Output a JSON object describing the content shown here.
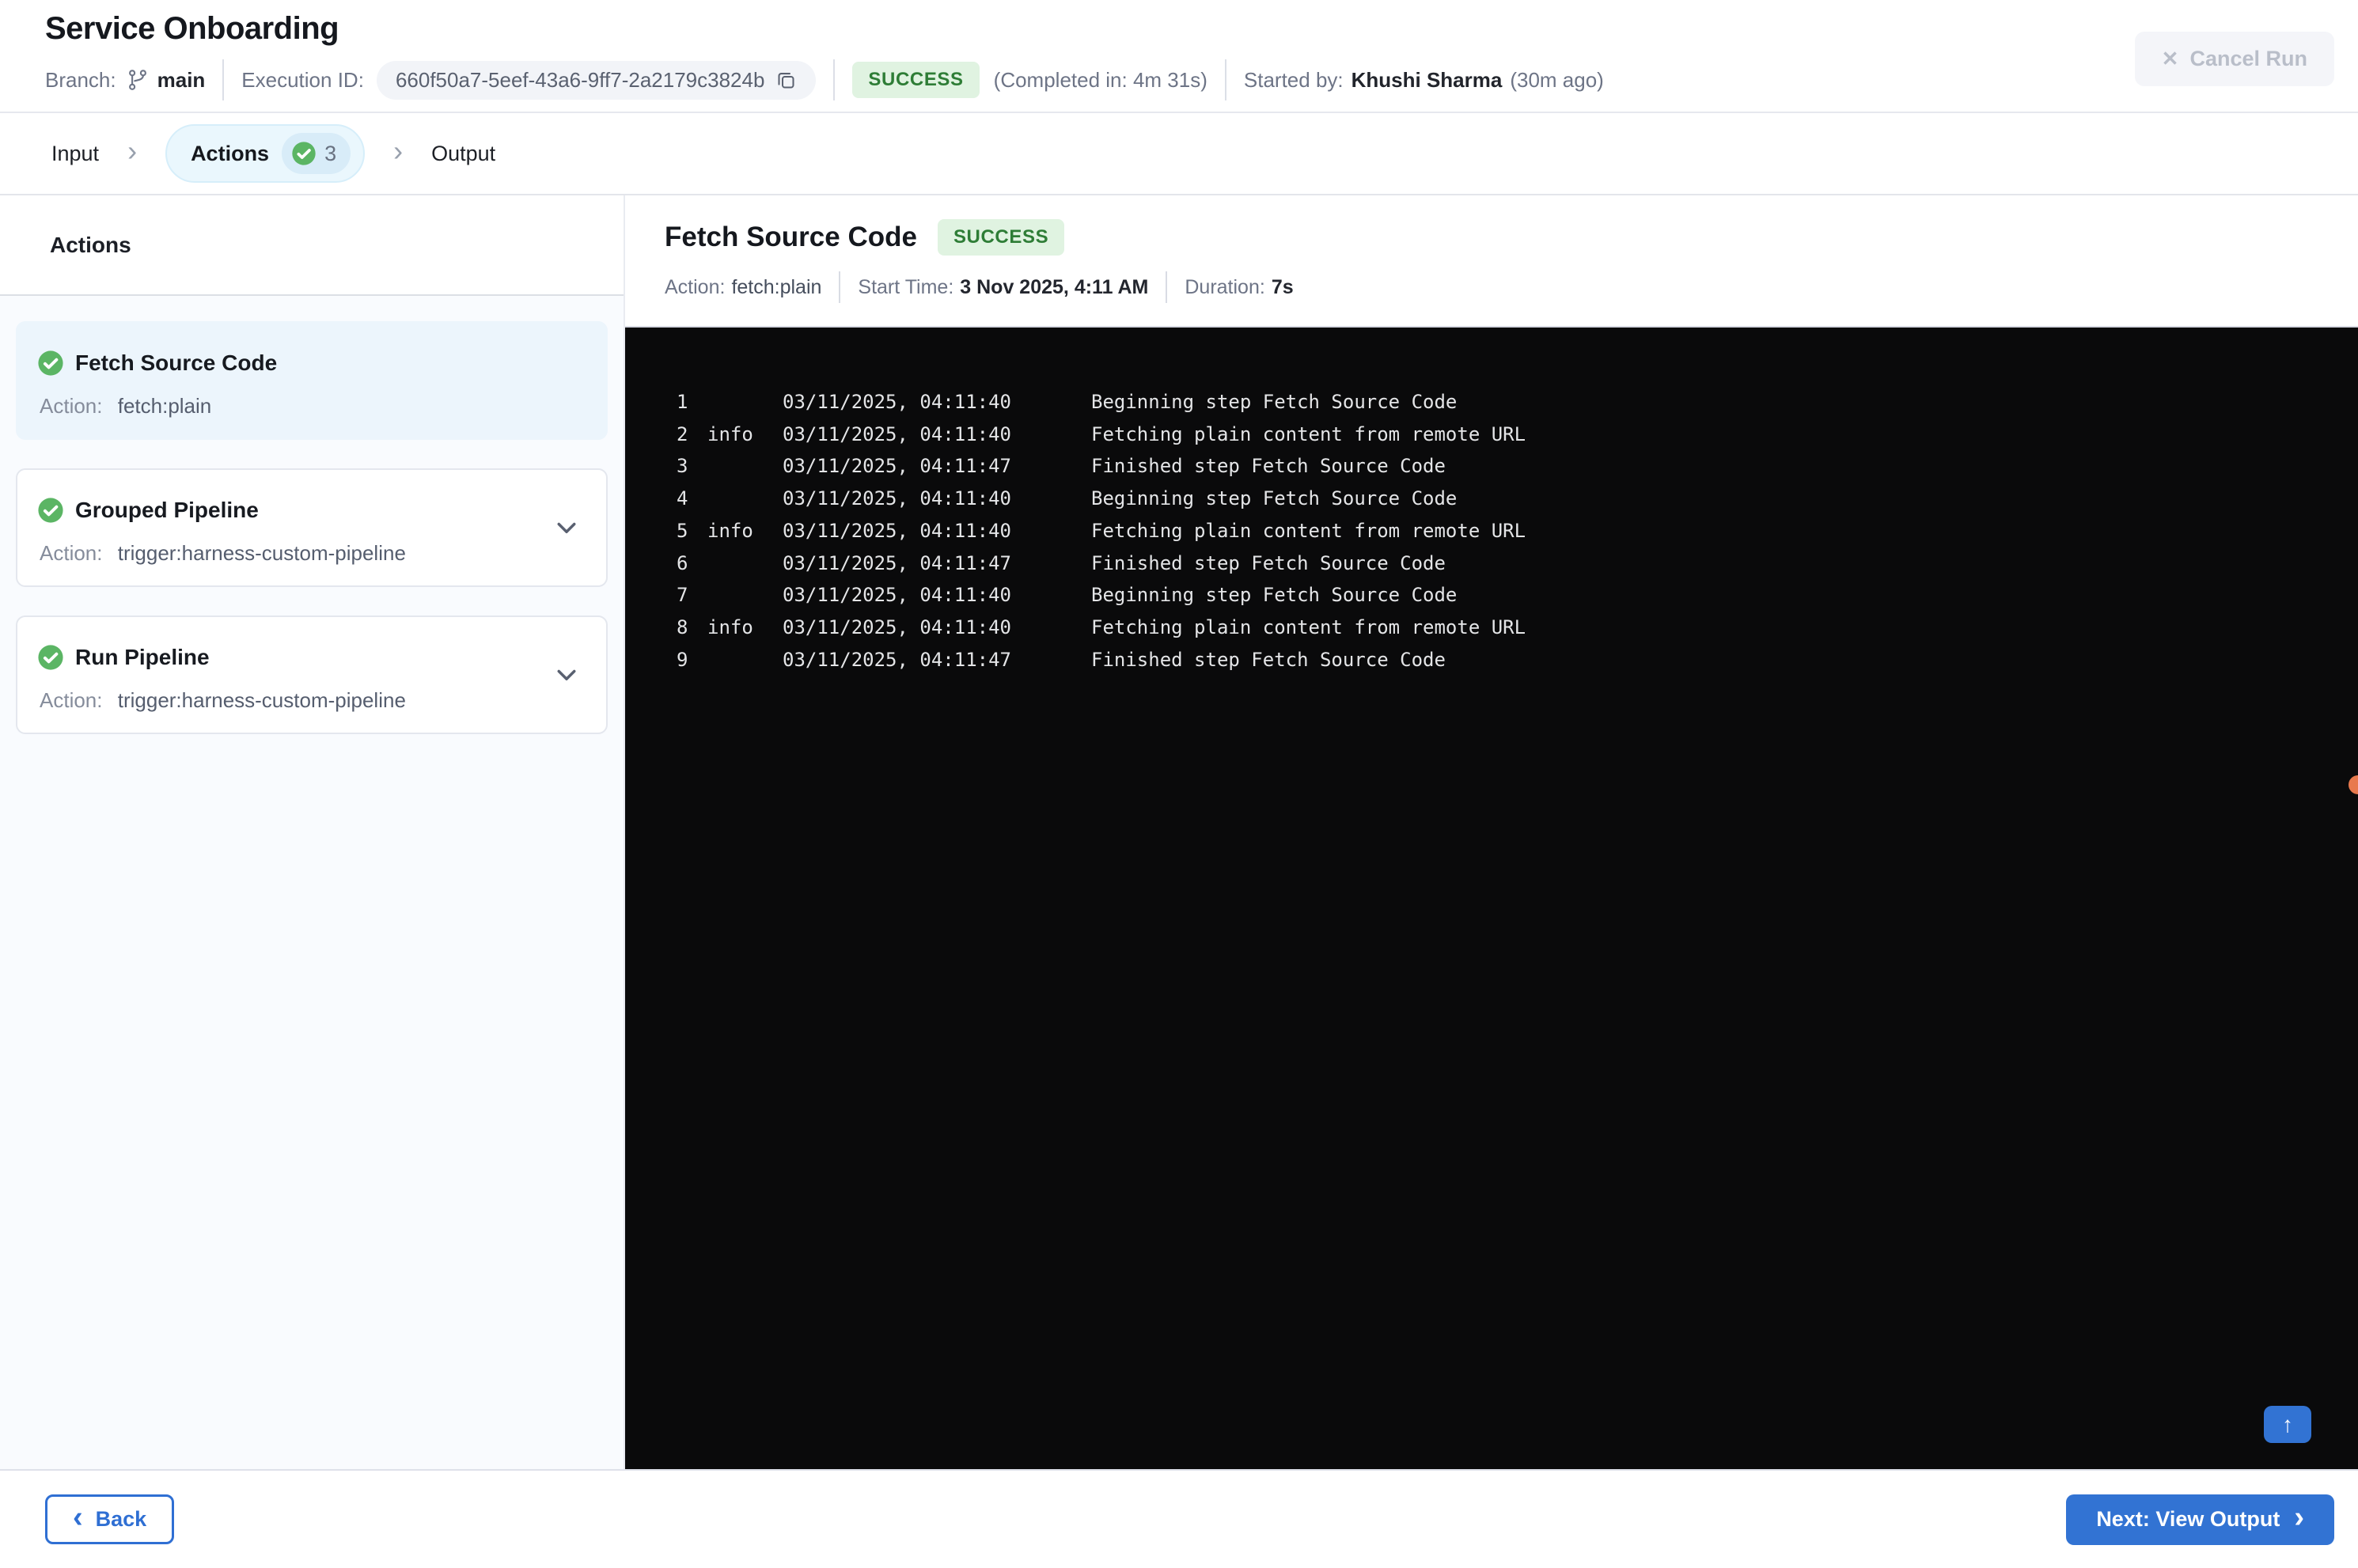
{
  "header": {
    "title": "Service Onboarding",
    "branch_label": "Branch:",
    "branch_name": "main",
    "execution_id_label": "Execution ID:",
    "execution_id": "660f50a7-5eef-43a6-9ff7-2a2179c3824b",
    "status_badge": "SUCCESS",
    "completed_in": "(Completed in: 4m 31s)",
    "started_by_label": "Started by:",
    "started_by_name": "Khushi Sharma",
    "started_ago": "(30m ago)",
    "cancel_button_label": "Cancel Run",
    "cancel_icon": "✕"
  },
  "tabs": {
    "items": [
      {
        "label": "Input",
        "active": false
      },
      {
        "label": "Actions",
        "active": true,
        "badge_count": "3"
      },
      {
        "label": "Output",
        "active": false
      }
    ],
    "separator": "›"
  },
  "sidebar": {
    "heading": "Actions",
    "action_label": "Action:",
    "cards": [
      {
        "title": "Fetch Source Code",
        "action": "fetch:plain",
        "status": "success",
        "selected": true,
        "expandable": false
      },
      {
        "title": "Grouped Pipeline",
        "action": "trigger:harness-custom-pipeline",
        "status": "success",
        "selected": false,
        "expandable": true
      },
      {
        "title": "Run Pipeline",
        "action": "trigger:harness-custom-pipeline",
        "status": "success",
        "selected": false,
        "expandable": true
      }
    ]
  },
  "detail": {
    "title": "Fetch Source Code",
    "status_badge": "SUCCESS",
    "action_label": "Action:",
    "action_value": "fetch:plain",
    "start_time_label": "Start Time:",
    "start_time_value": "3 Nov 2025, 4:11 AM",
    "duration_label": "Duration:",
    "duration_value": "7s"
  },
  "console": {
    "lines": [
      {
        "num": "1",
        "level": "",
        "timestamp": "03/11/2025, 04:11:40",
        "message": "Beginning step Fetch Source Code"
      },
      {
        "num": "2",
        "level": "info",
        "timestamp": "03/11/2025, 04:11:40",
        "message": "Fetching plain content from remote URL"
      },
      {
        "num": "3",
        "level": "",
        "timestamp": "03/11/2025, 04:11:47",
        "message": "Finished step Fetch Source Code"
      },
      {
        "num": "4",
        "level": "",
        "timestamp": "03/11/2025, 04:11:40",
        "message": "Beginning step Fetch Source Code"
      },
      {
        "num": "5",
        "level": "info",
        "timestamp": "03/11/2025, 04:11:40",
        "message": "Fetching plain content from remote URL"
      },
      {
        "num": "6",
        "level": "",
        "timestamp": "03/11/2025, 04:11:47",
        "message": "Finished step Fetch Source Code"
      },
      {
        "num": "7",
        "level": "",
        "timestamp": "03/11/2025, 04:11:40",
        "message": "Beginning step Fetch Source Code"
      },
      {
        "num": "8",
        "level": "info",
        "timestamp": "03/11/2025, 04:11:40",
        "message": "Fetching plain content from remote URL"
      },
      {
        "num": "9",
        "level": "",
        "timestamp": "03/11/2025, 04:11:47",
        "message": "Finished step Fetch Source Code"
      }
    ],
    "scroll_top_icon": "↑"
  },
  "footer": {
    "back_chevron": "‹",
    "back_button_label": "Back",
    "next_button_label": "Next: View Output",
    "next_chevron": "›"
  },
  "colors": {
    "accent_blue": "#3273d3",
    "success_icon_green": "#5bb564",
    "success_badge_bg": "#e0f3e1",
    "success_badge_text": "#2e7d36",
    "console_bg": "#0a0a0b",
    "notification_orange": "#e8794d",
    "selected_card_bg": "#ecf5fc",
    "active_tab_bg": "#eaf7fd"
  }
}
